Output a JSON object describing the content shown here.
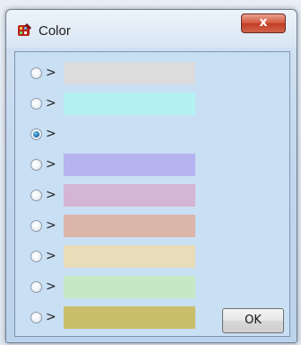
{
  "window": {
    "title": "Color",
    "close_label": "x",
    "app_icon": "paint-palette-icon"
  },
  "options": [
    {
      "chevron": ">",
      "color": "#dcdcdc",
      "selected": false
    },
    {
      "chevron": ">",
      "color": "#b4f1f2",
      "selected": false
    },
    {
      "chevron": ">",
      "color": "",
      "selected": true
    },
    {
      "chevron": ">",
      "color": "#b5b3f0",
      "selected": false
    },
    {
      "chevron": ">",
      "color": "#d4b5d3",
      "selected": false
    },
    {
      "chevron": ">",
      "color": "#ddb6ab",
      "selected": false
    },
    {
      "chevron": ">",
      "color": "#e8dcb9",
      "selected": false
    },
    {
      "chevron": ">",
      "color": "#c6e8c5",
      "selected": false
    },
    {
      "chevron": ">",
      "color": "#c9bf6a",
      "selected": false
    }
  ],
  "ok_label": "OK"
}
